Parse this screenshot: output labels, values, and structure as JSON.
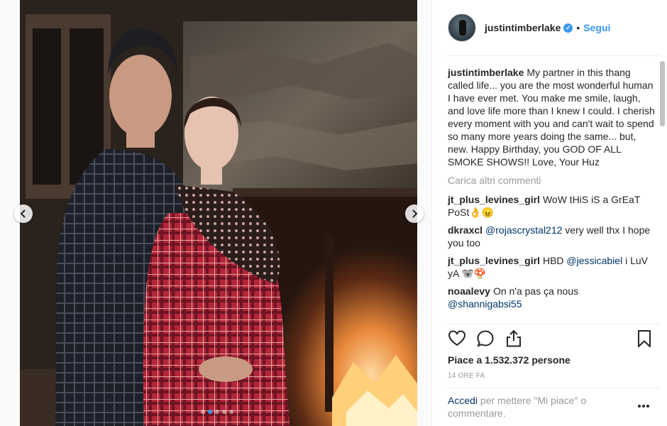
{
  "post": {
    "username": "justintimberlake",
    "bullet": "•",
    "follow_label": "Segui",
    "caption": {
      "user": "justintimberlake",
      "text": "My partner in this thang called life... you are the most wonderful human I have ever met. You make me smile, laugh, and love life more than I knew I could. I cherish every moment with you and can't wait to spend so many more years doing the same... but, new. Happy Birthday, you GOD OF ALL SMOKE SHOWS!! Love, Your Huz"
    },
    "load_more_label": "Carica altri commenti",
    "comments": [
      {
        "user": "jt_plus_levines_girl",
        "text": "WoW tHiS iS a GrEaT PoSt👌😠",
        "mention": "",
        "after": ""
      },
      {
        "user": "dkraxcl",
        "text": "",
        "mention": "@rojascrystal212",
        "after": " very well thx I hope you too"
      },
      {
        "user": "jt_plus_levines_girl",
        "text": "HBD ",
        "mention": "@jessicabiel",
        "after": " i LuV yA 🐨🍄"
      },
      {
        "user": "noaalevy",
        "text": "On n'a pas ça nous ",
        "mention": "@shannigabsi55",
        "after": ""
      }
    ],
    "likes_label": "Piace a 1.532.372 persone",
    "time_label": "14 ORE FA",
    "login_link": "Accedi",
    "login_rest": " per mettere \"Mi piace\" o commentare."
  },
  "carousel": {
    "slide_count": 5,
    "active_index": 1
  },
  "colors": {
    "accent": "#3897f0",
    "link": "#003569",
    "muted": "#999999"
  },
  "icons": {
    "prev": "chevron-left-icon",
    "next": "chevron-right-icon",
    "like": "heart-icon",
    "comment": "speech-bubble-icon",
    "share": "share-icon",
    "save": "bookmark-icon",
    "more": "ellipsis-icon"
  }
}
